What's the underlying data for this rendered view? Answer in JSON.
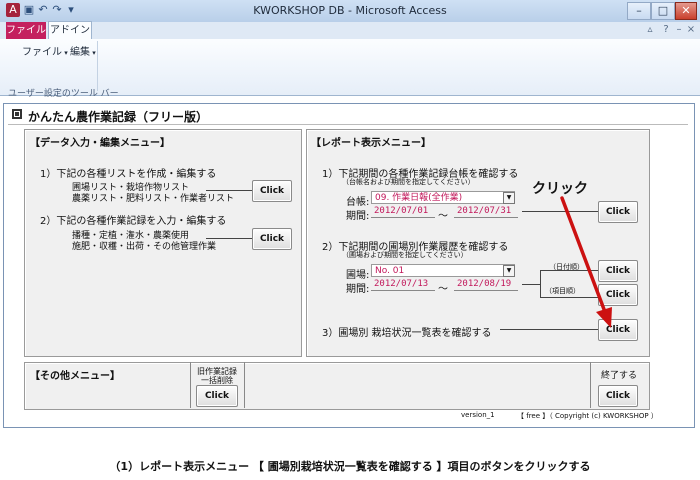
{
  "window": {
    "title": "KWORKSHOP DB - Microsoft Access",
    "minimize_glyph": "–",
    "maximize_glyph": "□",
    "close_glyph": "✕",
    "qat_icons": [
      "access-icon",
      "save-icon",
      "undo-icon",
      "redo-icon",
      "dropdown-icon"
    ]
  },
  "ribbon": {
    "file_tab": "ファイル",
    "addin_tab": "アドイン",
    "menu_file": "ファイル",
    "menu_edit": "編集",
    "toolbar_label": "ユーザー設定のツール バー",
    "help_glyph": "?",
    "collapse_glyph": "▵"
  },
  "form": {
    "title": "かんたん農作業記録（フリー版）",
    "data_menu": {
      "header": "【データ入力・編集メニュー】",
      "item1": "1）下記の各種リストを作成・編集する",
      "item1_sub1": "圃場リスト・栽培作物リスト",
      "item1_sub2": "農薬リスト・肥料リスト・作業者リスト",
      "item1_button": "Click",
      "item2": "2）下記の各種作業記録を入力・編集する",
      "item2_sub1": "播種・定植・潅水・農薬使用",
      "item2_sub2": "施肥・収穫・出荷・その他管理作業",
      "item2_button": "Click"
    },
    "report_menu": {
      "header": "【レポート表示メニュー】",
      "item1": "1）下記期間の各種作業記録台帳を確認する",
      "item1_note": "（台帳名および期間を指定してください）",
      "ledger_label": "台帳:",
      "ledger_value": "09. 作業日報(全作業)",
      "period_label": "期間:",
      "period1_from": "2012/07/01",
      "period_sep": "〜",
      "period1_to": "2012/07/31",
      "item1_button": "Click",
      "item2": "2）下記期間の圃場別作業履歴を確認する",
      "item2_note": "（圃場および期間を指定してください）",
      "field_label": "圃場:",
      "field_value": "No. 01",
      "period2_from": "2012/07/13",
      "period2_to": "2012/08/19",
      "by_date": "（日付順）",
      "by_item": "（項目順）",
      "item2_button_date": "Click",
      "item2_button_item": "Click",
      "item3": "3）圃場別 栽培状況一覧表を確認する",
      "item3_button": "Click"
    },
    "other_menu": {
      "header": "【その他メニュー】",
      "delete_title1": "旧作業記録",
      "delete_title2": "一括削除",
      "delete_button": "Click",
      "exit_label": "終了する",
      "exit_button": "Click"
    },
    "footer": {
      "version": "version_1",
      "copyright": "【 free 】（ Copyright (c) KWORKSHOP ）"
    }
  },
  "annotation": {
    "text": "クリック",
    "arrow_color": "#cc1111"
  },
  "caption": "（1）レポート表示メニュー 【 圃場別栽培状況一覧表を確認する 】項目のボタンをクリックする"
}
